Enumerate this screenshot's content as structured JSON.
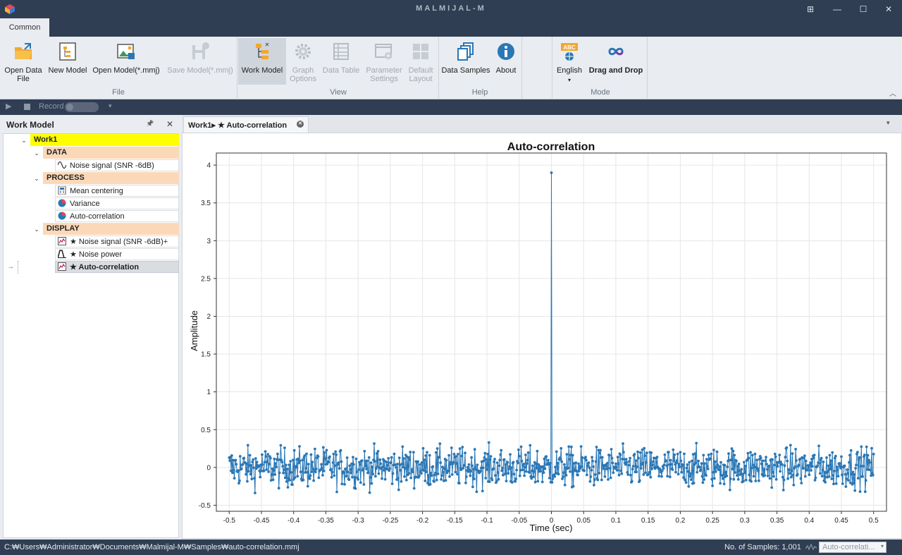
{
  "app": {
    "title": "MALMIJAL-M"
  },
  "window_controls": {
    "snap": "⊞",
    "minimize": "—",
    "maximize": "☐",
    "close": "✕"
  },
  "ribbon_tabs": [
    {
      "label": "Common"
    }
  ],
  "ribbon": {
    "groups": {
      "file": "File",
      "view": "View",
      "help": "Help",
      "mode": "Mode"
    },
    "buttons": {
      "open_data_file": {
        "line1": "Open Data",
        "line2": "File",
        "icon": "open-folder-icon"
      },
      "new_model": {
        "line1": "New Model",
        "icon": "new-model-icon"
      },
      "open_model": {
        "line1": "Open Model(*.mmj)",
        "icon": "open-model-icon"
      },
      "save_model": {
        "line1": "Save Model(*.mmj)",
        "icon": "save-model-icon"
      },
      "work_model": {
        "line1": "Work Model",
        "icon": "work-model-icon"
      },
      "graph_options": {
        "line1": "Graph",
        "line2": "Options",
        "icon": "gear-icon"
      },
      "data_table": {
        "line1": "Data Table",
        "icon": "table-icon"
      },
      "parameter_settings": {
        "line1": "Parameter",
        "line2": "Settings",
        "icon": "settings-window-icon"
      },
      "default_layout": {
        "line1": "Default",
        "line2": "Layout",
        "icon": "layout-icon"
      },
      "data_samples": {
        "line1": "Data Samples",
        "icon": "samples-icon"
      },
      "about": {
        "line1": "About",
        "icon": "info-icon"
      },
      "english": {
        "line1": "English",
        "icon_text": "ABC",
        "icon": "language-icon"
      },
      "drag_and_drop": {
        "line1": "Drag and Drop",
        "icon": "infinity-icon"
      }
    }
  },
  "record_bar": {
    "record_label": "Record"
  },
  "work_model_panel": {
    "title": "Work Model",
    "pin": "📌",
    "close": "✕",
    "tree": {
      "root": "Work1",
      "data_header": "DATA",
      "data_items": [
        "Noise signal (SNR -6dB)"
      ],
      "process_header": "PROCESS",
      "process_items": [
        "Mean centering",
        "Variance",
        "Auto-correlation"
      ],
      "display_header": "DISPLAY",
      "display_items": [
        "★ Noise signal (SNR -6dB)+",
        "★ Noise power",
        "★ Auto-correlation"
      ]
    }
  },
  "document_tab": {
    "label": "Work1▸ ★ Auto-correlation"
  },
  "chart_data": {
    "type": "line",
    "title": "Auto-correlation",
    "xlabel": "Time (sec)",
    "ylabel": "Amplitude",
    "xlim": [
      -0.52,
      0.52
    ],
    "ylim": [
      -0.58,
      4.16
    ],
    "xticks": [
      -0.5,
      -0.45,
      -0.4,
      -0.35,
      -0.3,
      -0.25,
      -0.2,
      -0.15,
      -0.1,
      -0.05,
      0,
      0.05,
      0.1,
      0.15,
      0.2,
      0.25,
      0.3,
      0.35,
      0.4,
      0.45,
      0.5
    ],
    "yticks": [
      -0.5,
      0,
      0.5,
      1,
      1.5,
      2,
      2.5,
      3,
      3.5,
      4
    ],
    "xtick_labels": [
      "-0.5",
      "-0.45",
      "-0.4",
      "-0.35",
      "-0.3",
      "-0.25",
      "-0.2",
      "-0.15",
      "-0.1",
      "-0.05",
      "0",
      "0.05",
      "0.1",
      "0.15",
      "0.2",
      "0.25",
      "0.3",
      "0.35",
      "0.4",
      "0.45",
      "0.5"
    ],
    "ytick_labels": [
      "-0.5",
      "0",
      "0.5",
      "1",
      "1.5",
      "2",
      "2.5",
      "3",
      "3.5",
      "4"
    ],
    "grid": true,
    "series": [
      {
        "color": "#2a77b5",
        "marker": "circle",
        "x_start": -0.5,
        "x_end": 0.5,
        "n_points": 1001,
        "peak": {
          "x": 0,
          "y": 3.9
        },
        "noise_range": [
          -0.42,
          0.52
        ]
      }
    ]
  },
  "status_bar": {
    "path": "C:₩Users₩Administrator₩Documents₩Malmijal-M₩Samples₩auto-correlation.mmj",
    "samples": "No. of Samples: 1,001",
    "selector": "Auto-correlati..."
  }
}
